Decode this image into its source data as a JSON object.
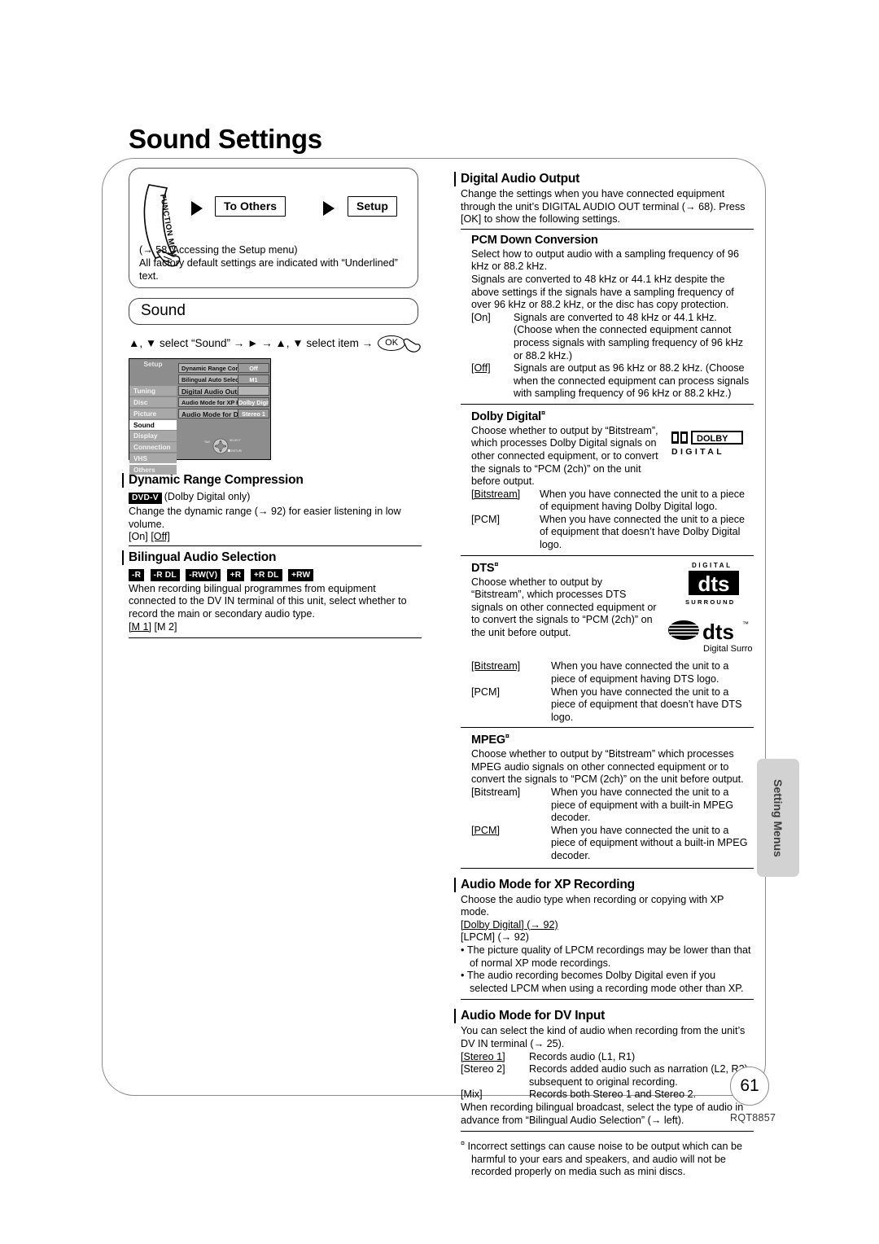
{
  "page": {
    "title": "Sound Settings",
    "number": "61",
    "code": "RQT8857",
    "side_tab": "Setting Menus"
  },
  "nav": {
    "function_menu_label": "FUNCTION MENU",
    "step1": "To Others",
    "step2": "Setup",
    "note_line1": "(→ 58, Accessing the Setup menu)",
    "note_line2": "All factory default settings are indicated with “Underlined” text."
  },
  "sound_bar": {
    "label": "Sound"
  },
  "select_instruction": {
    "text": "▲, ▼ select “Sound” → ► → ▲, ▼ select item →",
    "ok": "OK"
  },
  "osd": {
    "title": "Setup",
    "side_items": [
      {
        "label": "Tuning",
        "selected": false
      },
      {
        "label": "Disc",
        "selected": false
      },
      {
        "label": "Picture",
        "selected": false
      },
      {
        "label": "Sound",
        "selected": true
      },
      {
        "label": "Display",
        "selected": false
      },
      {
        "label": "Connection",
        "selected": false
      },
      {
        "label": "VHS",
        "selected": false
      },
      {
        "label": "Others",
        "selected": false
      }
    ],
    "rows": [
      {
        "label": "Dynamic Range Compression",
        "value": "Off"
      },
      {
        "label": "Bilingual Auto Selection",
        "value": "M1"
      },
      {
        "label": "Digital Audio Output",
        "value": ""
      },
      {
        "label": "Audio Mode for XP Recording",
        "value": "Dolby Digital"
      },
      {
        "label": "Audio Mode for DV Input",
        "value": "Stereo 1"
      }
    ],
    "dpad_labels": {
      "tab": "TAB",
      "select": "SELECT",
      "return": "RETURN"
    }
  },
  "left_sections": [
    {
      "heading": "Dynamic Range Compression",
      "badges": [
        "DVD-V"
      ],
      "badge_suffix": "(Dolby Digital only)",
      "body": "Change the dynamic range (→ 92) for easier listening in low volume.",
      "options_inline": [
        {
          "text": "[On]",
          "default": false
        },
        {
          "text": "[Off]",
          "default": true
        }
      ]
    },
    {
      "heading": "Bilingual Audio Selection",
      "badges": [
        "-R",
        "-R DL",
        "-RW(V)",
        "+R",
        "+R DL",
        "+RW"
      ],
      "badge_suffix": "",
      "body": "When recording bilingual programmes from equipment connected to the DV IN terminal of this unit, select whether to record the main or secondary audio type.",
      "options_inline": [
        {
          "text": "[M 1]",
          "default": true
        },
        {
          "text": "[M 2]",
          "default": false
        }
      ]
    }
  ],
  "right": {
    "digital_audio_output": {
      "heading": "Digital Audio Output",
      "body": "Change the settings when you have connected equipment through the unit’s DIGITAL AUDIO OUT terminal (→ 68). Press [OK] to show the following settings."
    },
    "pcm_down_conversion": {
      "heading": "PCM Down Conversion",
      "body1": "Select how to output audio with a sampling frequency of 96 kHz or 88.2 kHz.",
      "body2": "Signals are converted to 48 kHz or 44.1 kHz despite the above settings if the signals have a sampling frequency of over 96 kHz or 88.2 kHz, or the disc has copy protection.",
      "options": [
        {
          "key": "[On]",
          "default": false,
          "desc": "Signals are converted to 48 kHz or 44.1 kHz. (Choose when the connected equipment cannot process signals with sampling frequency of 96 kHz or 88.2 kHz.)"
        },
        {
          "key": "[Off]",
          "default": true,
          "desc": "Signals are output as 96 kHz or 88.2 kHz. (Choose when the connected equipment can process signals with sampling frequency of 96 kHz or 88.2 kHz.)"
        }
      ]
    },
    "dolby_digital": {
      "heading": "Dolby Digital",
      "footnote_mark": "¤",
      "body": "Choose whether to output by “Bitstream”, which processes Dolby Digital signals on other connected equipment, or to convert the signals to “PCM (2ch)” on the unit before output.",
      "logo": {
        "mark": "DOLBY",
        "sub": "D I G I T A L"
      },
      "options": [
        {
          "key": "[Bitstream]",
          "default": true,
          "desc": "When you have connected the unit to a piece of equipment having Dolby Digital logo."
        },
        {
          "key": "[PCM]",
          "default": false,
          "desc": "When you have connected the unit to a piece of equipment that doesn’t have Dolby Digital logo."
        }
      ]
    },
    "dts": {
      "heading": "DTS",
      "footnote_mark": "¤",
      "body": "Choose whether to output by “Bitstream”, which processes DTS signals on other connected equipment or to convert the signals to “PCM (2ch)” on the unit before output.",
      "logo1": {
        "top": "D I G I T A L",
        "mark": "dts",
        "bottom": "S U R R O U N D"
      },
      "logo2": {
        "mark": "dts",
        "tm": "™",
        "sub": "Digital Surround"
      },
      "options": [
        {
          "key": "[Bitstream]",
          "default": true,
          "desc": "When you have connected the unit to a piece of equipment having DTS logo."
        },
        {
          "key": "[PCM]",
          "default": false,
          "desc": "When you have connected the unit to a piece of equipment that doesn’t have DTS logo."
        }
      ]
    },
    "mpeg": {
      "heading": "MPEG",
      "footnote_mark": "¤",
      "body": "Choose whether to output by “Bitstream” which processes MPEG audio signals on other connected equipment or to convert the signals to “PCM (2ch)” on the unit before output.",
      "options": [
        {
          "key": "[Bitstream]",
          "default": false,
          "desc": "When you have connected the unit to a piece of equipment with a built-in MPEG decoder."
        },
        {
          "key": "[PCM]",
          "default": true,
          "desc": "When you have connected the unit to a piece of equipment without a built-in MPEG decoder."
        }
      ]
    },
    "audio_mode_xp": {
      "heading": "Audio Mode for XP Recording",
      "body": "Choose the audio type when recording or copying with XP mode.",
      "options_inline": [
        {
          "text": "[Dolby Digital] (→ 92)",
          "default": true
        },
        {
          "text": "[LPCM] (→ 92)",
          "default": false
        }
      ],
      "bullets": [
        "The picture quality of LPCM recordings may be lower than that of normal XP mode recordings.",
        "The audio recording becomes Dolby Digital even if you selected LPCM when using a recording mode other than XP."
      ]
    },
    "audio_mode_dv": {
      "heading": "Audio Mode for DV Input",
      "body": "You can select the kind of audio when recording from the unit’s DV IN terminal (→ 25).",
      "options": [
        {
          "key": "[Stereo 1]",
          "default": true,
          "desc": "Records audio (L1, R1)"
        },
        {
          "key": "[Stereo 2]",
          "default": false,
          "desc": "Records added audio such as narration (L2, R2) subsequent to original recording."
        },
        {
          "key": "[Mix]",
          "default": false,
          "desc": "Records both Stereo 1 and Stereo 2."
        }
      ],
      "closing": "When recording bilingual broadcast, select the type of audio in advance from “Bilingual Audio Selection” (→ left)."
    },
    "footnote": {
      "mark": "¤",
      "text": "Incorrect settings can cause noise to be output which can be harmful to your ears and speakers, and audio will not be recorded properly on media such as mini discs."
    }
  }
}
